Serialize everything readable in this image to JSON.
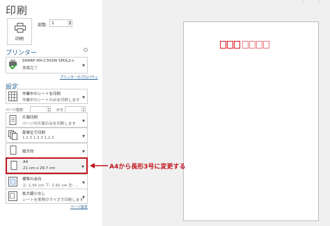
{
  "backstage": {
    "title": "印刷",
    "print_button_label": "印刷",
    "copies_label": "部数:",
    "copies_value": "1"
  },
  "printer": {
    "section_title": "プリンター",
    "name": "SHARP MX-C302W SPDL2-c",
    "status": "準備完了",
    "properties_link": "プリンターのプロパティ"
  },
  "settings": {
    "section_title": "設定",
    "print_what": {
      "line1": "作業中のシートを印刷",
      "line2": "作業中のシートのみを印刷します"
    },
    "pages_label": "ページ指定:",
    "pages_to_label": "から",
    "sides": {
      "line1": "片面印刷",
      "line2": "ページの片面のみを印刷します"
    },
    "collation": {
      "line1": "部単位で印刷",
      "line2": "1,2,3     1,2,3     1,2,3"
    },
    "orientation": {
      "line1": "縦方向"
    },
    "paper": {
      "line1": "A4",
      "line2": "21 cm x 29.7 cm"
    },
    "margins": {
      "line1": "標準の余白",
      "line2": "上: 1.91 cm 下: 1.91 cm 左: ..."
    },
    "scaling": {
      "line1": "拡大縮小なし",
      "line2": "シートを実際のサイズで印刷します"
    },
    "page_setup_link": "ページ設定"
  },
  "annotation": {
    "callout": "A4から長形3号に変更する",
    "color": "#c0141c"
  },
  "colors": {
    "accent": "#2a6496",
    "highlight": "#c0141c",
    "preview_bg": "#f0f0f0"
  }
}
